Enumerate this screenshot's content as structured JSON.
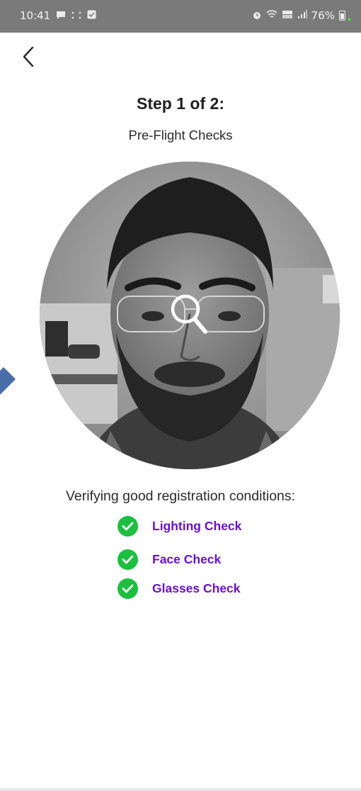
{
  "status_bar": {
    "time": "10:41",
    "left_icons": [
      "chat-icon",
      "dots-icon",
      "checkbox-icon"
    ],
    "right_icons": [
      "alarm-icon",
      "wifi-icon",
      "volte-icon",
      "signal-icon"
    ],
    "battery_percent": "76%",
    "battery_level": 0.76
  },
  "header": {
    "back_label": "<"
  },
  "step": {
    "title": "Step 1 of 2:",
    "subtitle": "Pre-Flight Checks"
  },
  "camera": {
    "overlay_icon": "magnifier-icon"
  },
  "verification": {
    "intro": "Verifying good registration conditions:",
    "checks": [
      {
        "label": "Lighting Check",
        "status": "passed"
      },
      {
        "label": "Face Check",
        "status": "passed"
      },
      {
        "label": "Glasses Check",
        "status": "passed"
      }
    ]
  },
  "colors": {
    "status_bar_bg": "#7a7a7a",
    "check_green": "#1cbf3f",
    "check_label_purple": "#6a11c9",
    "side_arrow_blue": "#4a6fa8"
  }
}
